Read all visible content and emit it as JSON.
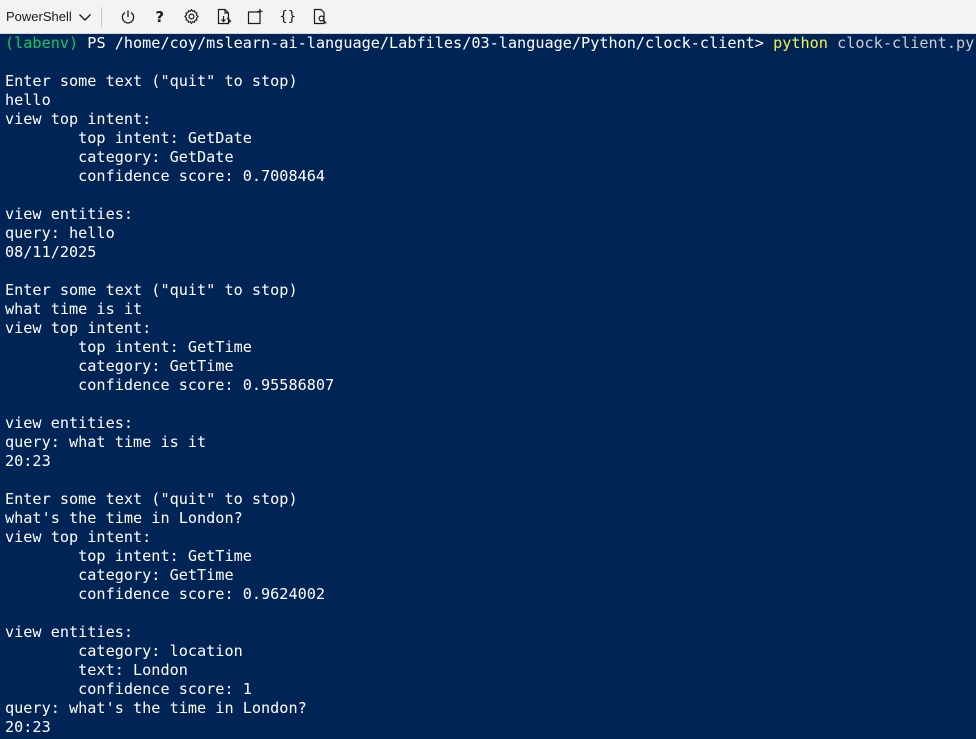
{
  "toolbar": {
    "shell_label": "PowerShell",
    "icons": [
      "chevron-down-icon",
      "power-icon",
      "help-icon",
      "settings-icon",
      "upload-download-icon",
      "new-session-icon",
      "editor-braces-icon",
      "web-preview-icon"
    ],
    "help_glyph": "?",
    "braces_glyph": "{}"
  },
  "terminal": {
    "colors": {
      "background": "#012456",
      "text": "#ffffff",
      "env": "#13c75f",
      "command": "#f2f250",
      "argument": "#cccccc"
    },
    "prompt": {
      "env": "(labenv)",
      "path": " PS /home/coy/mslearn-ai-language/Labfiles/03-language/Python/clock-client> ",
      "command": "python",
      "argument": " clock-client.py"
    },
    "lines": [
      "",
      "Enter some text (\"quit\" to stop)",
      "hello",
      "view top intent:",
      "        top intent: GetDate",
      "        category: GetDate",
      "        confidence score: 0.7008464",
      "",
      "view entities:",
      "query: hello",
      "08/11/2025",
      "",
      "Enter some text (\"quit\" to stop)",
      "what time is it",
      "view top intent:",
      "        top intent: GetTime",
      "        category: GetTime",
      "        confidence score: 0.95586807",
      "",
      "view entities:",
      "query: what time is it",
      "20:23",
      "",
      "Enter some text (\"quit\" to stop)",
      "what's the time in London?",
      "view top intent:",
      "        top intent: GetTime",
      "        category: GetTime",
      "        confidence score: 0.9624002",
      "",
      "view entities:",
      "        category: location",
      "        text: London",
      "        confidence score: 1",
      "query: what's the time in London?",
      "20:23"
    ]
  }
}
